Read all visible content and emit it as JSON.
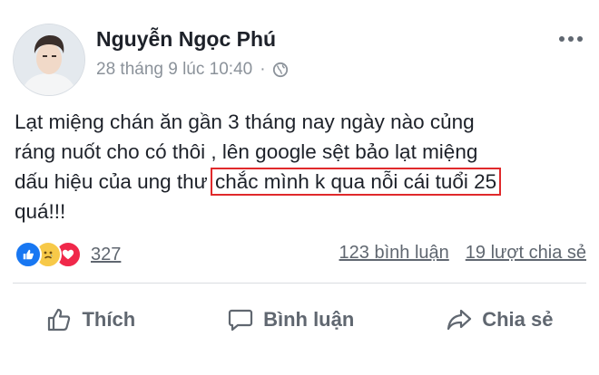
{
  "post": {
    "author": "Nguyễn Ngọc Phú",
    "timestamp": "28 tháng 9 lúc 10:40",
    "separator": "·",
    "privacy_icon": "globe-icon",
    "content_lines": [
      "Lạt miệng chán ăn gần 3 tháng nay ngày nào củng",
      "ráng nuốt cho có thôi , lên google sệt bảo lạt miệng",
      "dấu hiệu của ung thư ",
      "quá!!!"
    ],
    "highlighted_text": "chắc mình k qua nỗi cái tuổi 25",
    "highlight_color": "#e0292b"
  },
  "reactions": {
    "icons": [
      "like-icon",
      "sad-icon",
      "love-icon"
    ],
    "count": "327"
  },
  "stats": {
    "comments": "123 bình luận",
    "shares": "19 lượt chia sẻ"
  },
  "actions": {
    "like": "Thích",
    "comment": "Bình luận",
    "share": "Chia sẻ"
  }
}
